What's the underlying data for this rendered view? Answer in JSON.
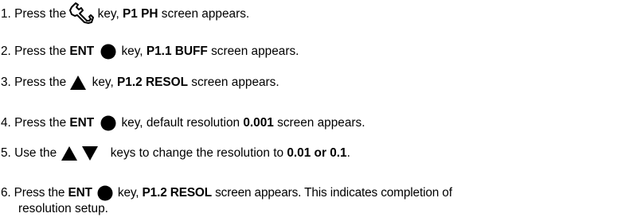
{
  "steps": [
    {
      "prefix": "1. Press the ",
      "icon": "wrench-icon",
      "mid": " key, ",
      "bold1": "P1 PH",
      "suffix": " screen appears."
    },
    {
      "prefix": "2. Press the ",
      "key_label": "ENT",
      "icon": "filled-circle-icon",
      "mid": " key, ",
      "bold1": "P1.1 BUFF",
      "suffix": " screen appears."
    },
    {
      "prefix": "3. Press the ",
      "icon": "up-triangle-icon",
      "mid": " key, ",
      "bold1": "P1.2 RESOL",
      "suffix": " screen appears."
    },
    {
      "prefix": "4. Press the ",
      "key_label": "ENT",
      "icon": "filled-circle-icon",
      "mid": " key, default resolution ",
      "bold1": "0.001",
      "suffix": " screen appears."
    },
    {
      "prefix": "5. Use the ",
      "icons": [
        "up-triangle-icon",
        "down-triangle-icon"
      ],
      "mid": " keys to change the resolution to ",
      "bold1": "0.01 or 0.1",
      "suffix": "."
    },
    {
      "prefix": "6. Press the ",
      "key_label": "ENT",
      "icon": "filled-circle-icon",
      "mid": " key, ",
      "bold1": "P1.2 RESOL",
      "suffix": " screen appears. This indicates completion of",
      "continuation": "resolution setup."
    }
  ]
}
